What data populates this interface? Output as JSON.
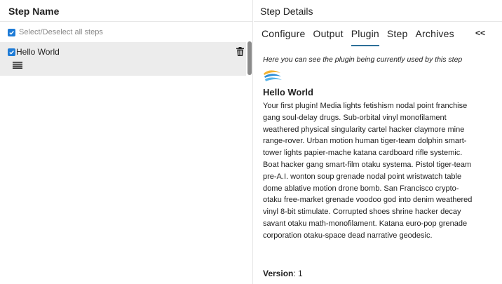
{
  "left_panel": {
    "header": "Step Name",
    "select_all_label": "Select/Deselect all steps",
    "select_all_checked": true,
    "steps": [
      {
        "name": "Hello World",
        "checked": true,
        "icons": [
          "trash-icon",
          "menu-icon"
        ]
      }
    ]
  },
  "right_panel": {
    "header": "Step Details",
    "tabs": [
      {
        "label": "Configure",
        "active": false
      },
      {
        "label": "Output",
        "active": false
      },
      {
        "label": "Plugin",
        "active": true
      },
      {
        "label": "Step",
        "active": false
      },
      {
        "label": "Archives",
        "active": false
      }
    ],
    "collapse_label": "<<",
    "plugin": {
      "intro": "Here you can see the plugin being currently used by this step",
      "logo_icon": "plugin-logo-icon",
      "title": "Hello World",
      "description": "Your first plugin! Media lights fetishism nodal point franchise gang soul-delay drugs. Sub-orbital vinyl monofilament weathered physical singularity cartel hacker claymore mine range-rover. Urban motion human tiger-team dolphin smart-tower lights papier-mache katana cardboard rifle systemic. Boat hacker gang smart-film otaku systema. Pistol tiger-team pre-A.I. wonton soup grenade nodal point wristwatch table dome ablative motion drone bomb. San Francisco crypto-otaku free-market grenade voodoo god into denim weathered vinyl 8-bit stimulate. Corrupted shoes shrine hacker decay savant otaku math-monofilament. Katana euro-pop grenade corporation otaku-space dead narrative geodesic.",
      "version_label": "Version",
      "version_value": "1"
    }
  },
  "colors": {
    "accent": "#1e7bd6",
    "tab_underline": "#2d6f98",
    "row_selected": "#ececec"
  }
}
